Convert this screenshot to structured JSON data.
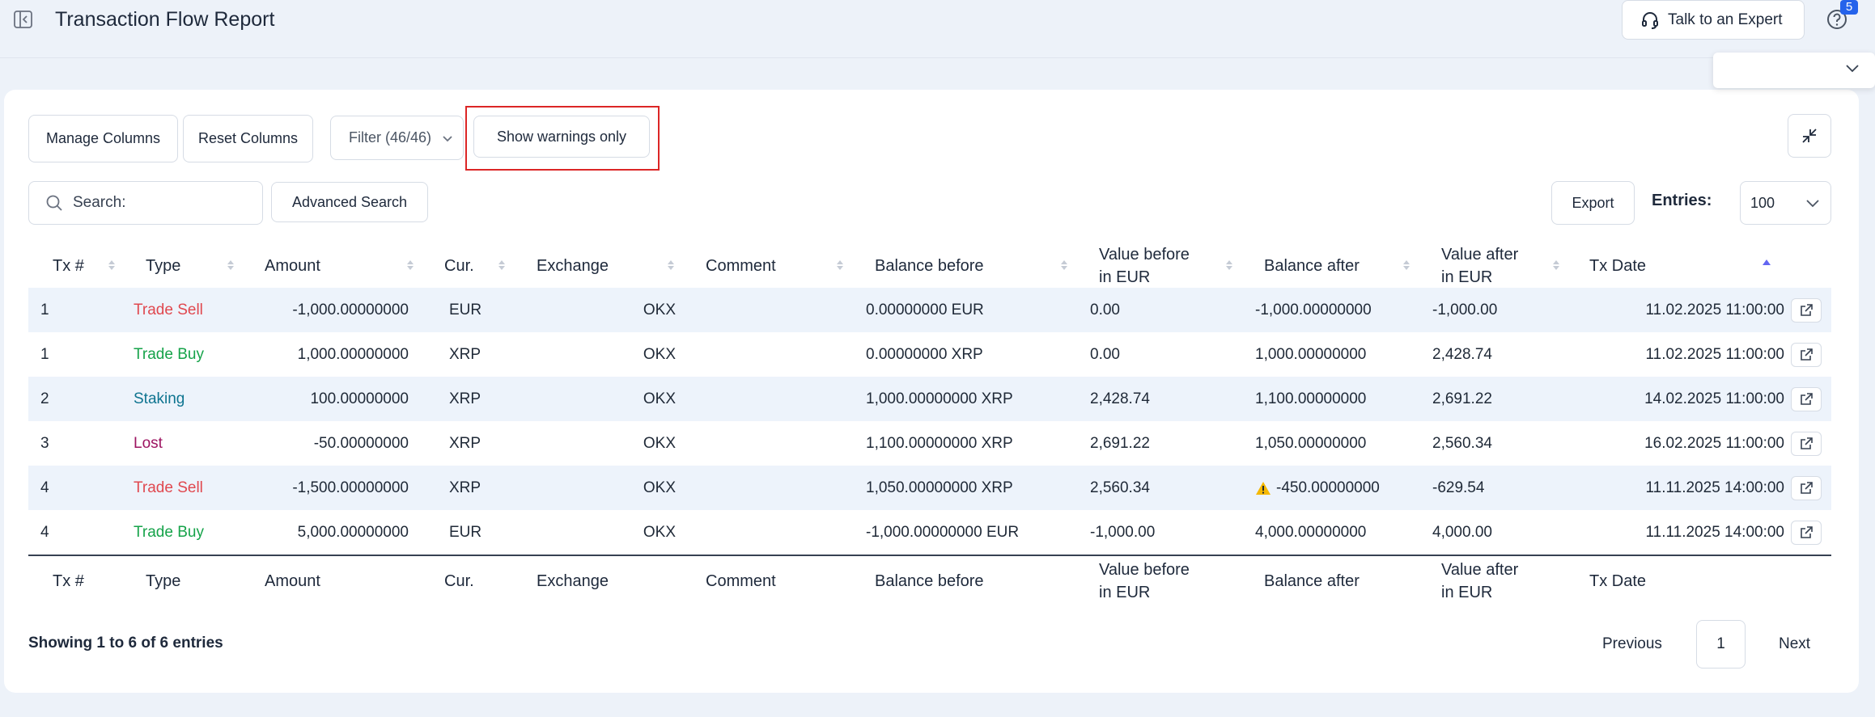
{
  "header": {
    "title": "Transaction Flow Report",
    "expert_button": "Talk to an Expert",
    "help_badge": "5"
  },
  "toolbar": {
    "manage_columns": "Manage Columns",
    "reset_columns": "Reset Columns",
    "filter": "Filter (46/46)",
    "show_warnings": "Show warnings only",
    "advanced_search": "Advanced Search",
    "export": "Export",
    "entries_label": "Entries:",
    "entries_value": "100"
  },
  "search": {
    "placeholder": "Search:"
  },
  "table": {
    "columns": {
      "txn": "Tx #",
      "type": "Type",
      "amount": "Amount",
      "cur": "Cur.",
      "exchange": "Exchange",
      "comment": "Comment",
      "balance_before": "Balance before",
      "value_before_1": "Value before",
      "value_before_2": "in EUR",
      "balance_after": "Balance after",
      "value_after_1": "Value after",
      "value_after_2": "in EUR",
      "date": "Tx Date"
    },
    "rows": [
      {
        "txn": "1",
        "type": "Trade Sell",
        "type_class": "t-sell",
        "amount": "-1,000.00000000",
        "cur": "EUR",
        "exchange": "OKX",
        "comment": "",
        "balance_before": "0.00000000 EUR",
        "value_before": "0.00",
        "balance_after": "-1,000.00000000",
        "warning": false,
        "value_after": "-1,000.00",
        "date": "11.02.2025 11:00:00"
      },
      {
        "txn": "1",
        "type": "Trade Buy",
        "type_class": "t-buy",
        "amount": "1,000.00000000",
        "cur": "XRP",
        "exchange": "OKX",
        "comment": "",
        "balance_before": "0.00000000 XRP",
        "value_before": "0.00",
        "balance_after": "1,000.00000000",
        "warning": false,
        "value_after": "2,428.74",
        "date": "11.02.2025 11:00:00"
      },
      {
        "txn": "2",
        "type": "Staking",
        "type_class": "t-staking",
        "amount": "100.00000000",
        "cur": "XRP",
        "exchange": "OKX",
        "comment": "",
        "balance_before": "1,000.00000000 XRP",
        "value_before": "2,428.74",
        "balance_after": "1,100.00000000",
        "warning": false,
        "value_after": "2,691.22",
        "date": "14.02.2025 11:00:00"
      },
      {
        "txn": "3",
        "type": "Lost",
        "type_class": "t-lost",
        "amount": "-50.00000000",
        "cur": "XRP",
        "exchange": "OKX",
        "comment": "",
        "balance_before": "1,100.00000000 XRP",
        "value_before": "2,691.22",
        "balance_after": "1,050.00000000",
        "warning": false,
        "value_after": "2,560.34",
        "date": "16.02.2025 11:00:00"
      },
      {
        "txn": "4",
        "type": "Trade Sell",
        "type_class": "t-sell",
        "amount": "-1,500.00000000",
        "cur": "XRP",
        "exchange": "OKX",
        "comment": "",
        "balance_before": "1,050.00000000 XRP",
        "value_before": "2,560.34",
        "balance_after": "-450.00000000",
        "warning": true,
        "value_after": "-629.54",
        "date": "11.11.2025 14:00:00"
      },
      {
        "txn": "4",
        "type": "Trade Buy",
        "type_class": "t-buy",
        "amount": "5,000.00000000",
        "cur": "EUR",
        "exchange": "OKX",
        "comment": "",
        "balance_before": "-1,000.00000000 EUR",
        "value_before": "-1,000.00",
        "balance_after": "4,000.00000000",
        "warning": false,
        "value_after": "4,000.00",
        "date": "11.11.2025 14:00:00"
      }
    ]
  },
  "footer": {
    "showing": "Showing 1 to 6 of 6 entries",
    "previous": "Previous",
    "page": "1",
    "next": "Next"
  },
  "colors": {
    "accent": "#2563eb",
    "highlight": "#dc2626",
    "sell": "#e0484f",
    "buy": "#16a34a",
    "staking": "#0e7490",
    "lost": "#9d1461",
    "row_alt": "#edf3fb"
  }
}
